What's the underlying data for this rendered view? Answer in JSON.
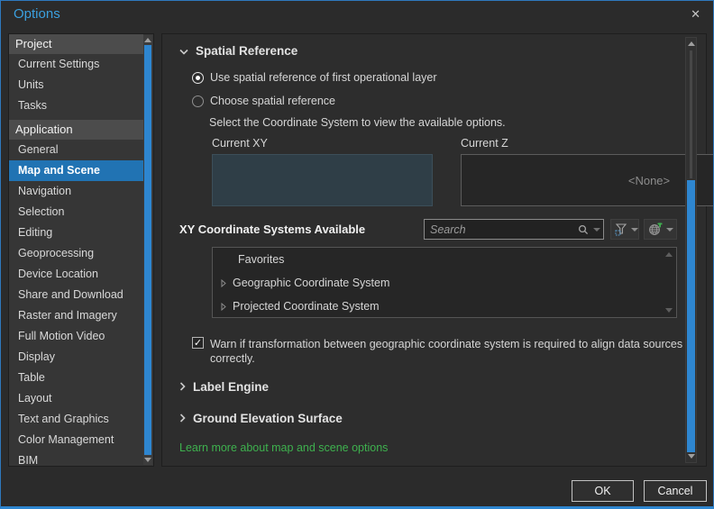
{
  "window": {
    "title": "Options",
    "close_glyph": "✕"
  },
  "colors": {
    "accent_selection": "#2173B3",
    "scrollbar_thumb": "#2E86D0",
    "title_blue": "#3BA0DF",
    "link_green": "#3EB14E",
    "current_xy_fill": "#2F3E47"
  },
  "sidebar": {
    "project_header": "Project",
    "project_items": [
      "Current Settings",
      "Units",
      "Tasks"
    ],
    "application_header": "Application",
    "application_items": [
      "General",
      "Map and Scene",
      "Navigation",
      "Selection",
      "Editing",
      "Geoprocessing",
      "Device Location",
      "Share and Download",
      "Raster and Imagery",
      "Full Motion Video",
      "Display",
      "Table",
      "Layout",
      "Text and Graphics",
      "Color Management",
      "BIM"
    ],
    "selected_item": "Map and Scene"
  },
  "main": {
    "spatial_reference": {
      "title": "Spatial Reference",
      "radio_first_layer": "Use spatial reference of first operational layer",
      "radio_choose": "Choose spatial reference",
      "instruction": "Select the Coordinate System to view the available options.",
      "current_xy_label": "Current XY",
      "current_z_label": "Current Z",
      "current_z_value": "<None>",
      "xy_available_label": "XY Coordinate Systems Available",
      "search_placeholder": "Search",
      "tree_items": [
        "Favorites",
        "Geographic Coordinate System",
        "Projected Coordinate System"
      ],
      "warn_checkbox_checked": true,
      "warn_check_glyph": "✓",
      "warn_text": "Warn if transformation between geographic coordinate system is required to align data sources correctly."
    },
    "label_engine_title": "Label Engine",
    "ground_elevation_title": "Ground Elevation Surface",
    "learn_link": "Learn more about map and scene options"
  },
  "footer": {
    "ok_label": "OK",
    "cancel_label": "Cancel"
  }
}
